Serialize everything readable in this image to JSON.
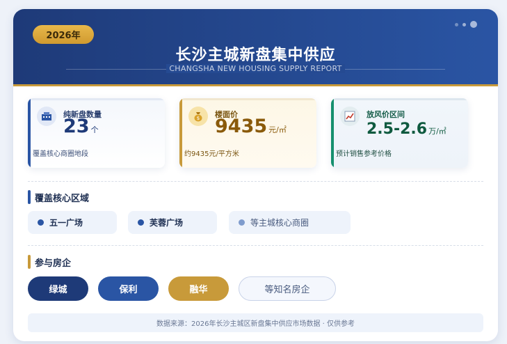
{
  "header": {
    "year": "2026年",
    "title": "长沙主城新盘集中供应",
    "subtitle": "CHANGSHA NEW HOUSING SUPPLY REPORT"
  },
  "stats": [
    {
      "label": "纯新盘数量",
      "value": "23",
      "unit": "个",
      "note": "覆盖核心商圈地段",
      "icon": "building-icon"
    },
    {
      "label": "楼面价",
      "value": "9435",
      "unit": "元/㎡",
      "note": "约9435元/平方米",
      "icon": "money-bag-icon"
    },
    {
      "label": "放风价区间",
      "value": "2.5-2.6",
      "unit": "万/㎡",
      "note": "预计销售参考价格",
      "icon": "chart-up-icon"
    }
  ],
  "areas": {
    "title": "覆盖核心区域",
    "items": [
      "五一广场",
      "芙蓉广场",
      "等主城核心商圈"
    ]
  },
  "developers": {
    "title": "参与房企",
    "items": [
      "绿城",
      "保利",
      "融华",
      "等知名房企"
    ]
  },
  "footer": "数据来源：2026年长沙主城区新盘集中供应市场数据 · 仅供参考",
  "colors": {
    "navy": "#1e3a78",
    "blue": "#2a55a4",
    "gold": "#c89a3a",
    "green": "#16906e"
  }
}
